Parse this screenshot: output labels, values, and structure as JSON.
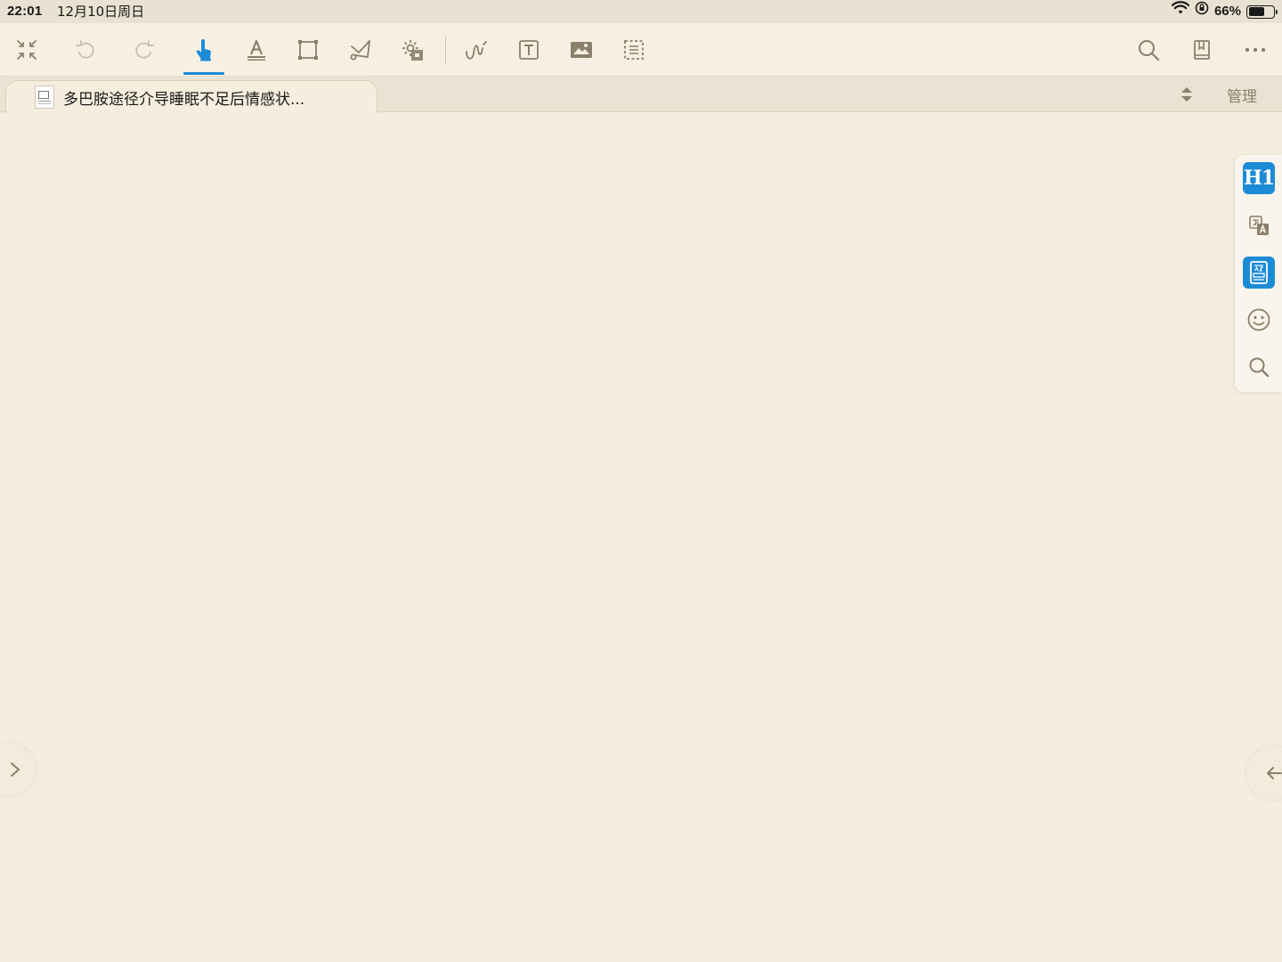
{
  "status_bar": {
    "time": "22:01",
    "date": "12月10日周日",
    "battery": "66%",
    "battery_level": 0.66,
    "icons": [
      "wifi-icon",
      "orientation-lock-icon",
      "battery-icon"
    ]
  },
  "toolbar": {
    "left_tools": [
      {
        "name": "collapse-icon"
      },
      {
        "name": "undo-icon"
      },
      {
        "name": "redo-icon"
      },
      {
        "name": "hand-pointer-icon",
        "active": true
      },
      {
        "name": "text-highlight-icon"
      },
      {
        "name": "rectangle-select-icon"
      },
      {
        "name": "lasso-icon"
      },
      {
        "name": "settings-gear-icon"
      },
      {
        "name": "freehand-pen-icon"
      },
      {
        "name": "text-box-icon"
      },
      {
        "name": "image-icon"
      },
      {
        "name": "dashed-select-icon"
      }
    ],
    "right_tools": [
      {
        "name": "search-icon"
      },
      {
        "name": "bookmark-icon"
      },
      {
        "name": "more-icon"
      }
    ],
    "accent_color": "#1C8BD6",
    "icon_color": "#8B7F6A"
  },
  "tabbar": {
    "document_title": "多巴胺途径介导睡眠不足后情感状...",
    "manage_label": "管理"
  },
  "side_panel": {
    "h1_label": "H1",
    "items": [
      "heading-icon",
      "translate-icon",
      "dictionary-icon",
      "emoji-icon",
      "search-icon"
    ]
  },
  "colors": {
    "background": "#F5EEDE",
    "toolbar": "#F6F0E2",
    "tabbar": "#EAE3D3",
    "accent": "#1C8BD6"
  }
}
